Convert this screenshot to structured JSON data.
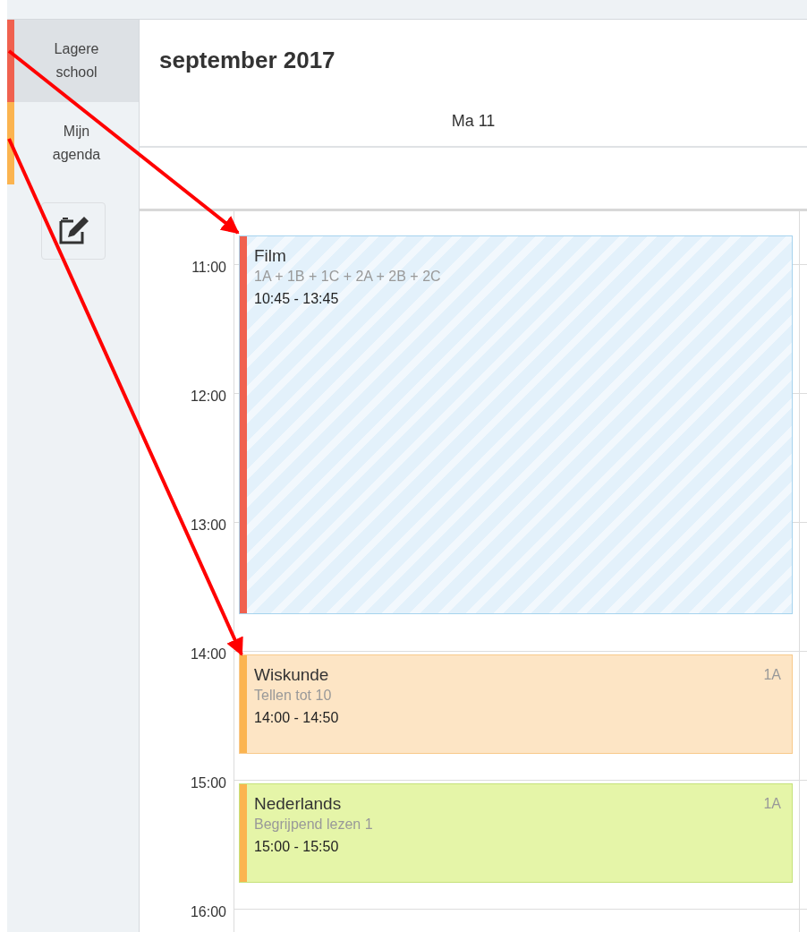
{
  "sidebar": {
    "calendars": [
      {
        "label": "Lagere school",
        "color": "#f0614f",
        "selected": true
      },
      {
        "label": "Mijn agenda",
        "color": "#fbb450",
        "selected": false
      }
    ]
  },
  "header": {
    "title": "september 2017",
    "day_label": "Ma 11"
  },
  "time_labels": [
    "11:00",
    "12:00",
    "13:00",
    "14:00",
    "15:00",
    "16:00"
  ],
  "events": [
    {
      "kind": "hatched",
      "title": "Film",
      "subtitle": "1A + 1B + 1C + 2A + 2B + 2C",
      "time": "10:45 - 13:45",
      "color": "#f0614f"
    },
    {
      "kind": "plain",
      "title": "Wiskunde",
      "subtitle": "Tellen tot 10",
      "time": "14:00 - 14:50",
      "group": "1A",
      "color": "#fbb450"
    },
    {
      "kind": "green",
      "title": "Nederlands",
      "subtitle": "Begrijpend lezen 1",
      "time": "15:00 - 15:50",
      "group": "1A",
      "color": "#fbb450"
    }
  ]
}
